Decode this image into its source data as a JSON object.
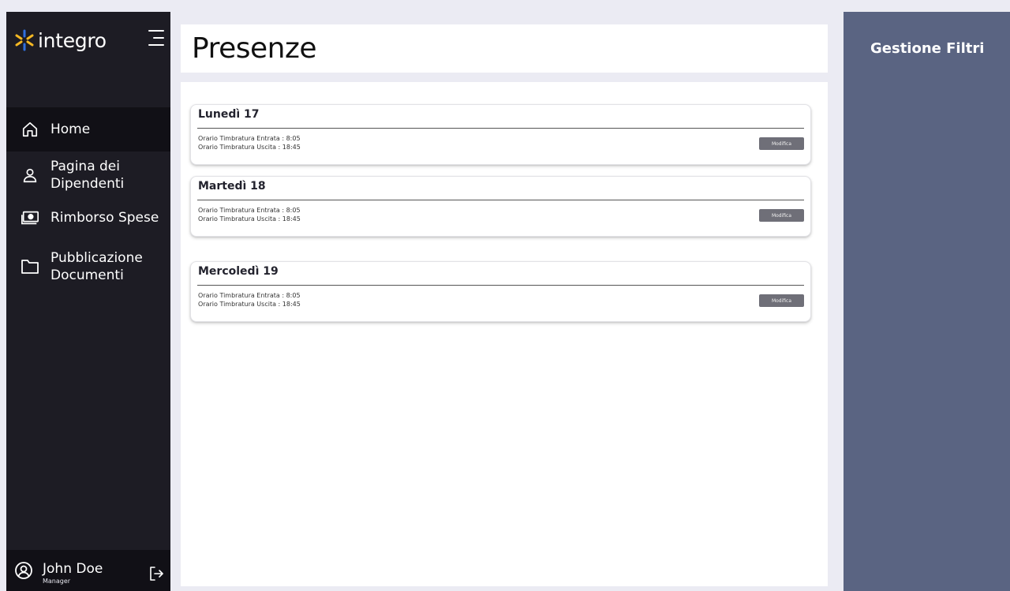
{
  "app": {
    "name": "integro"
  },
  "sidebar": {
    "items": [
      {
        "label": "Home",
        "icon": "home-icon",
        "active": true
      },
      {
        "label": "Pagina dei\nDipendenti",
        "icon": "user-icon",
        "active": false
      },
      {
        "label": "Rimborso Spese",
        "icon": "money-icon",
        "active": false
      },
      {
        "label": "Pubblicazione\nDocumenti",
        "icon": "folder-icon",
        "active": false
      }
    ]
  },
  "user": {
    "name": "John Doe",
    "role": "Manager"
  },
  "header": {
    "title": "Presenze"
  },
  "days": [
    {
      "title": "Lunedì 17",
      "entrata": "Orario Timbratura Entrata : 8:05",
      "uscita": "Orario Timbratura Uscita : 18:45",
      "button": "Modifica"
    },
    {
      "title": "Martedì 18",
      "entrata": "Orario Timbratura Entrata : 8:05",
      "uscita": "Orario Timbratura Uscita : 18:45",
      "button": "Modifica"
    },
    {
      "title": "Mercoledì 19",
      "entrata": "Orario Timbratura Entrata : 8:05",
      "uscita": "Orario Timbratura Uscita : 18:45",
      "button": "Modifica"
    }
  ],
  "filters": {
    "title": "Gestione Filtri"
  },
  "colors": {
    "sidebar": "#1d1c24",
    "active": "#111016",
    "filters_panel": "#5a6482",
    "brand_yellow": "#f5b823",
    "brand_blue": "#2f6fe0"
  }
}
